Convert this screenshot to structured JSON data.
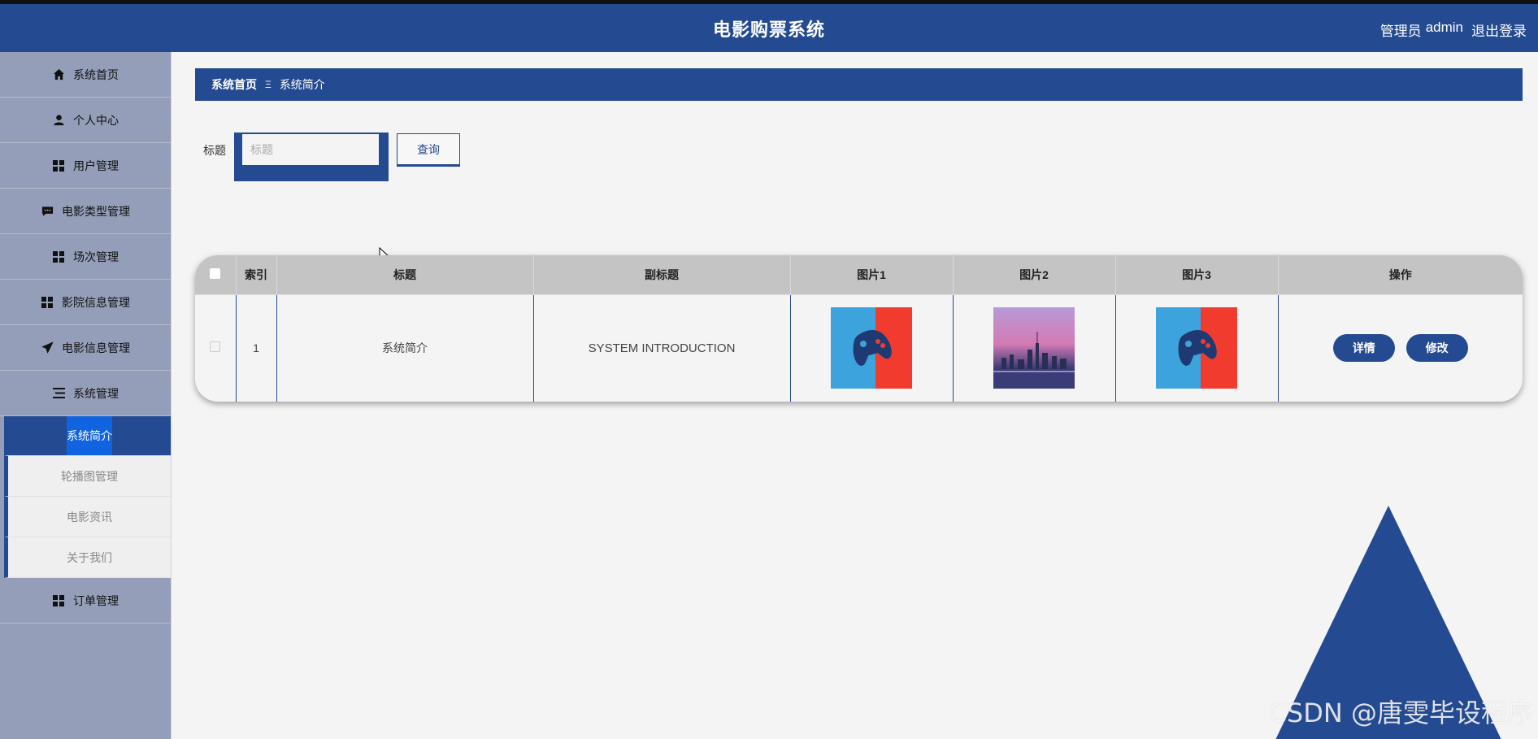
{
  "header": {
    "app_title": "电影购票系统",
    "user_role": "管理员",
    "username": "admin",
    "logout_label": "退出登录"
  },
  "sidebar": {
    "items": [
      {
        "label": "系统首页",
        "icon": "home-icon"
      },
      {
        "label": "个人中心",
        "icon": "user-icon"
      },
      {
        "label": "用户管理",
        "icon": "grid-icon"
      },
      {
        "label": "电影类型管理",
        "icon": "chat-icon"
      },
      {
        "label": "场次管理",
        "icon": "grid-icon"
      },
      {
        "label": "影院信息管理",
        "icon": "grid-icon"
      },
      {
        "label": "电影信息管理",
        "icon": "send-icon"
      },
      {
        "label": "系统管理",
        "icon": "list-icon"
      }
    ],
    "sub_items": [
      {
        "label": "系统简介",
        "active": true
      },
      {
        "label": "轮播图管理",
        "active": false
      },
      {
        "label": "电影资讯",
        "active": false
      },
      {
        "label": "关于我们",
        "active": false
      }
    ],
    "last_item": {
      "label": "订单管理",
      "icon": "grid-icon"
    }
  },
  "breadcrumb": {
    "home": "系统首页",
    "separator": "Ξ",
    "current": "系统简介"
  },
  "search": {
    "label": "标题",
    "placeholder": "标题",
    "value": "",
    "button_label": "查询"
  },
  "table": {
    "columns": [
      "索引",
      "标题",
      "副标题",
      "图片1",
      "图片2",
      "图片3",
      "操作"
    ],
    "rows": [
      {
        "index": "1",
        "title": "系统简介",
        "subtitle": "SYSTEM INTRODUCTION",
        "image1": "gamepad-image",
        "image2": "city-skyline-image",
        "image3": "gamepad-image",
        "actions": [
          "详情",
          "修改"
        ]
      }
    ]
  },
  "watermark": "CSDN @唐雯毕设程序",
  "colors": {
    "primary": "#244a91",
    "sidebar_bg": "#959eb8",
    "page_bg": "#f4f4f4",
    "table_header": "#c4c4c4"
  }
}
